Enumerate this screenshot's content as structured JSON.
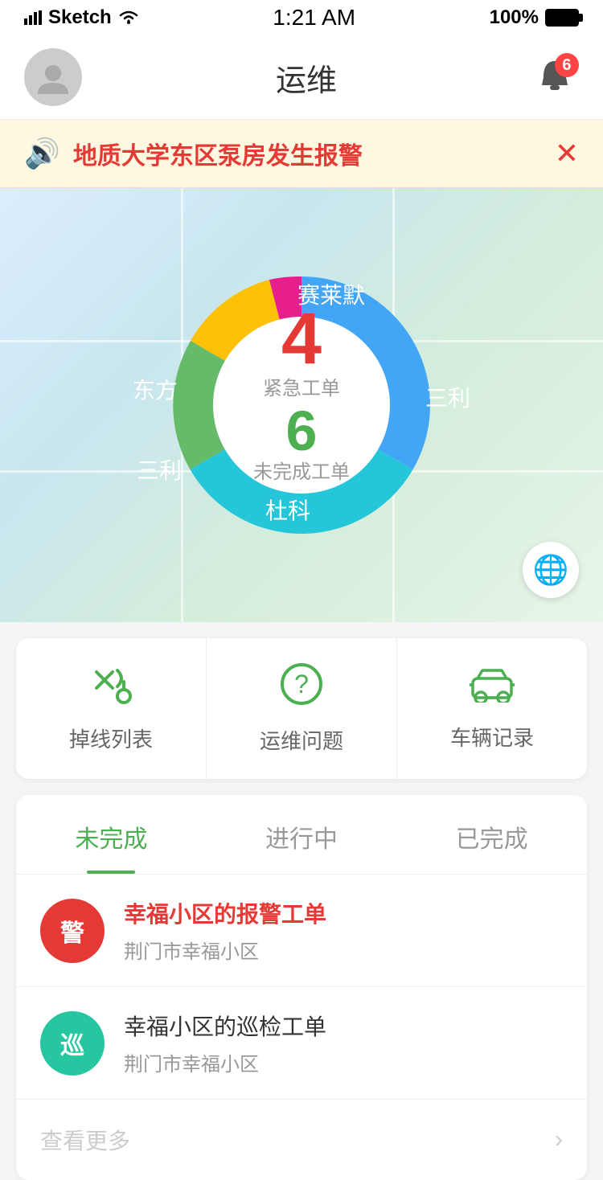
{
  "statusBar": {
    "carrier": "Sketch",
    "time": "1:21 AM",
    "battery": "100%"
  },
  "header": {
    "title": "运维",
    "bellCount": "6"
  },
  "alert": {
    "text": "地质大学东区泵房发生报警"
  },
  "chart": {
    "urgentCount": "4",
    "urgentLabel": "紧急工单",
    "incompleteCount": "6",
    "incompleteLabel": "未完成工单",
    "segments": [
      {
        "label": "赛莱默",
        "color": "#e91e8c"
      },
      {
        "label": "三利",
        "color": "#42a5f5"
      },
      {
        "label": "杜科",
        "color": "#26c6da"
      },
      {
        "label": "三利",
        "color": "#66bb6a"
      },
      {
        "label": "东方",
        "color": "#ffc107"
      }
    ]
  },
  "quickActions": [
    {
      "icon": "✦",
      "label": "掉线列表"
    },
    {
      "icon": "?",
      "label": "运维问题"
    },
    {
      "icon": "🚗",
      "label": "车辆记录"
    }
  ],
  "tabs": [
    {
      "label": "未完成",
      "active": true
    },
    {
      "label": "进行中",
      "active": false
    },
    {
      "label": "已完成",
      "active": false
    }
  ],
  "workOrders": [
    {
      "type": "urgent",
      "avatarChar": "警",
      "title": "幸福小区的报警工单",
      "location": "荆门市幸福小区"
    },
    {
      "type": "normal",
      "avatarChar": "巡",
      "title": "幸福小区的巡检工单",
      "location": "荆门市幸福小区"
    }
  ],
  "viewMore": "查看更多"
}
